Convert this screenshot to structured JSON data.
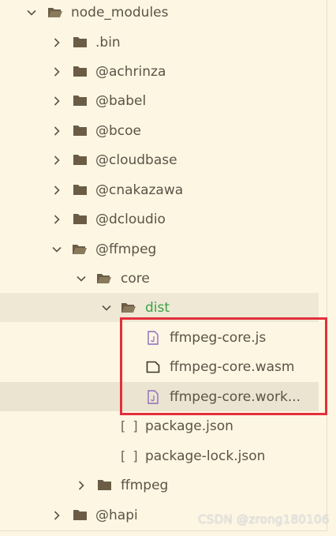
{
  "tree": {
    "root": {
      "label": "node_modules"
    },
    "bin": {
      "label": ".bin"
    },
    "achrinza": {
      "label": "@achrinza"
    },
    "babel": {
      "label": "@babel"
    },
    "bcoe": {
      "label": "@bcoe"
    },
    "cloudbase": {
      "label": "@cloudbase"
    },
    "cnakazawa": {
      "label": "@cnakazawa"
    },
    "dcloudio": {
      "label": "@dcloudio"
    },
    "ffmpeg_scope": {
      "label": "@ffmpeg"
    },
    "core": {
      "label": "core"
    },
    "dist": {
      "label": "dist"
    },
    "file_core_js": {
      "label": "ffmpeg-core.js"
    },
    "file_core_wasm": {
      "label": "ffmpeg-core.wasm"
    },
    "file_core_worker": {
      "label": "ffmpeg-core.work..."
    },
    "package_json": {
      "label": "package.json"
    },
    "package_lock": {
      "label": "package-lock.json"
    },
    "ffmpeg": {
      "label": "ffmpeg"
    },
    "hapi": {
      "label": "@hapi"
    }
  },
  "json_bracket": "[ ]",
  "watermark": {
    "text": "CSDN @zrong180106"
  },
  "colors": {
    "background": "#fdf6e3",
    "highlight_box": "#e2303b",
    "dist_label": "#3aa147",
    "folder": "#6b5d45",
    "js_icon": "#8e6bbf"
  }
}
